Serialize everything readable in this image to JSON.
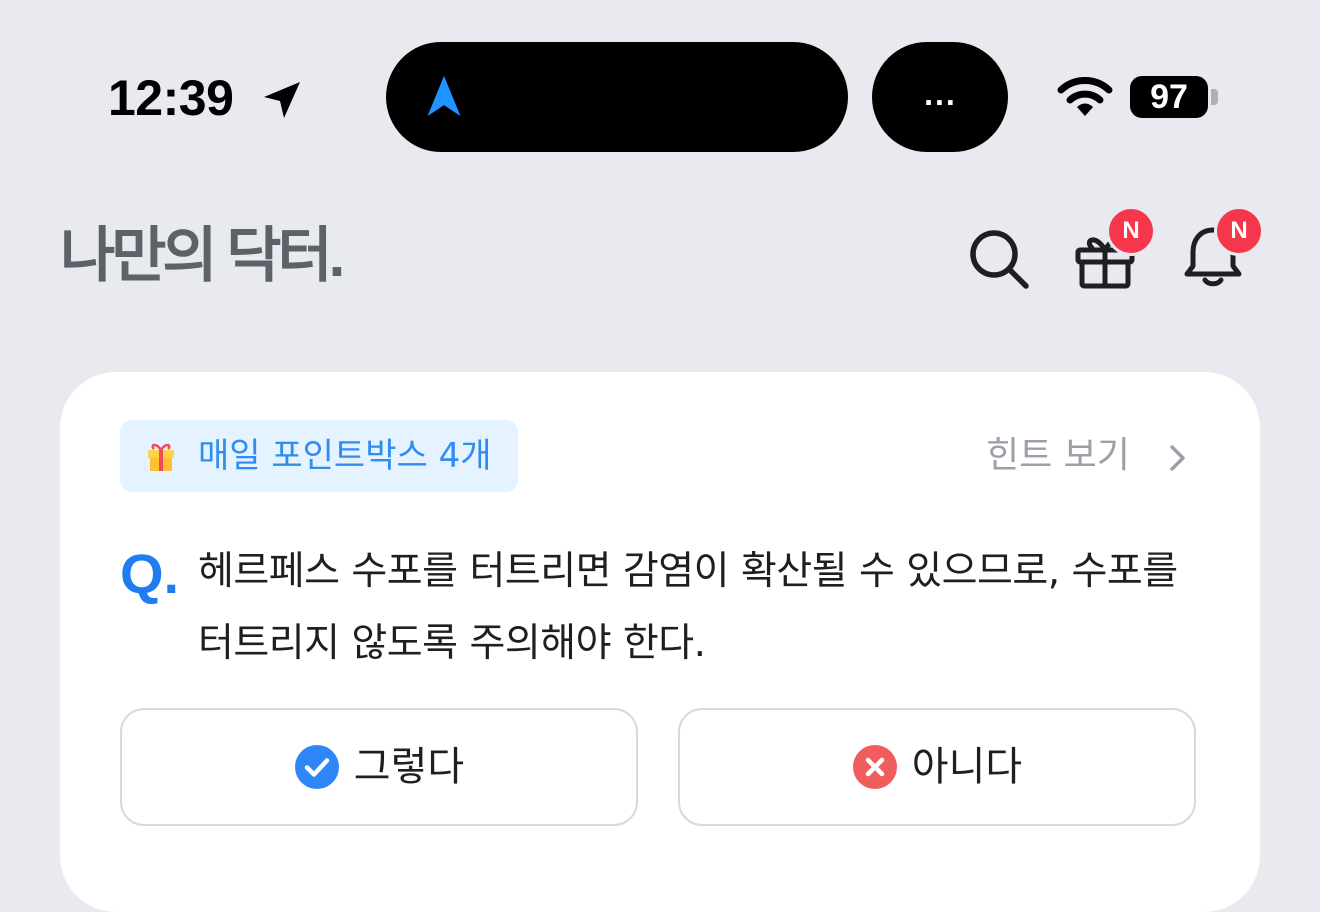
{
  "status_bar": {
    "time": "12:39",
    "location_icon": "location-arrow-icon",
    "island_dots": "...",
    "battery_level": "97",
    "wifi_icon": "wifi-icon"
  },
  "header": {
    "logo": "나만의 닥터.",
    "search_icon": "search-icon",
    "gift_icon": "gift-icon",
    "bell_icon": "bell-icon",
    "gift_badge": "N",
    "bell_badge": "N"
  },
  "quiz": {
    "reward_label": "매일 포인트박스 4개",
    "hint_label": "힌트 보기",
    "q_prefix": "Q.",
    "question": "헤르페스 수포를 터트리면 감염이 확산될 수 있으므로, 수포를 터트리지 않도록 주의해야 한다.",
    "yes_label": "그렇다",
    "no_label": "아니다"
  },
  "colors": {
    "accent": "#1f7cf1",
    "badge": "#f5364b",
    "yes_icon": "#2f86f6",
    "no_icon": "#f05d5d",
    "background": "#e9eaef"
  }
}
